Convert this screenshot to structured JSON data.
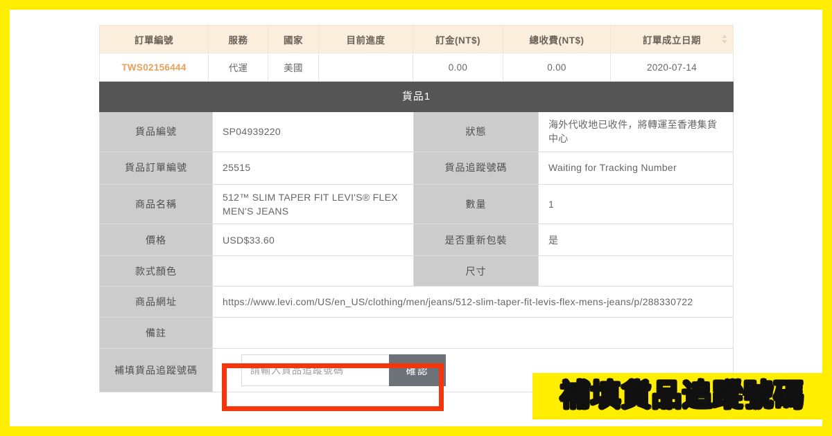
{
  "order_table": {
    "headers": [
      "訂單編號",
      "服務",
      "國家",
      "目前進度",
      "訂金(NT$)",
      "總收費(NT$)",
      "訂單成立日期"
    ],
    "sort_icon": "sort-updown-icon",
    "row": {
      "order_id": "TWS02156444",
      "service": "代運",
      "country": "美國",
      "progress": "",
      "deposit": "0.00",
      "total_fee": "0.00",
      "created_date": "2020-07-14"
    }
  },
  "item": {
    "banner_title": "貨品1",
    "rows": [
      {
        "label_left": "貨品編號",
        "value_left": "SP04939220",
        "label_right": "狀態",
        "value_right": "海外代收地已收件，將轉運至香港集貨中心"
      },
      {
        "label_left": "貨品訂單編號",
        "value_left": "25515",
        "label_right": "貨品追蹤號碼",
        "value_right": "Waiting for Tracking Number"
      },
      {
        "label_left": "商品名稱",
        "value_left": "512™ SLIM TAPER FIT LEVI'S® FLEX MEN'S JEANS",
        "label_right": "數量",
        "value_right": "1"
      },
      {
        "label_left": "價格",
        "value_left": "USD$33.60",
        "label_right": "是否重新包裝",
        "value_right": "是"
      },
      {
        "label_left": "款式顏色",
        "value_left": "",
        "label_right": "尺寸",
        "value_right": ""
      }
    ],
    "url_row": {
      "label": "商品網址",
      "value": "https://www.levi.com/US/en_US/clothing/men/jeans/512-slim-taper-fit-levis-flex-mens-jeans/p/288330722"
    },
    "note_row": {
      "label": "備註",
      "value": ""
    },
    "tracking_row": {
      "label": "補填貨品追蹤號碼",
      "input_placeholder": "請輸入貨品追蹤號碼",
      "input_value": "",
      "confirm_label": "確認"
    }
  },
  "annotation": {
    "caption": "補填貨品追蹤號碼",
    "highlight_color": "#f5360d",
    "banner_color": "#ffee00",
    "frame_color": "#ffee00"
  }
}
